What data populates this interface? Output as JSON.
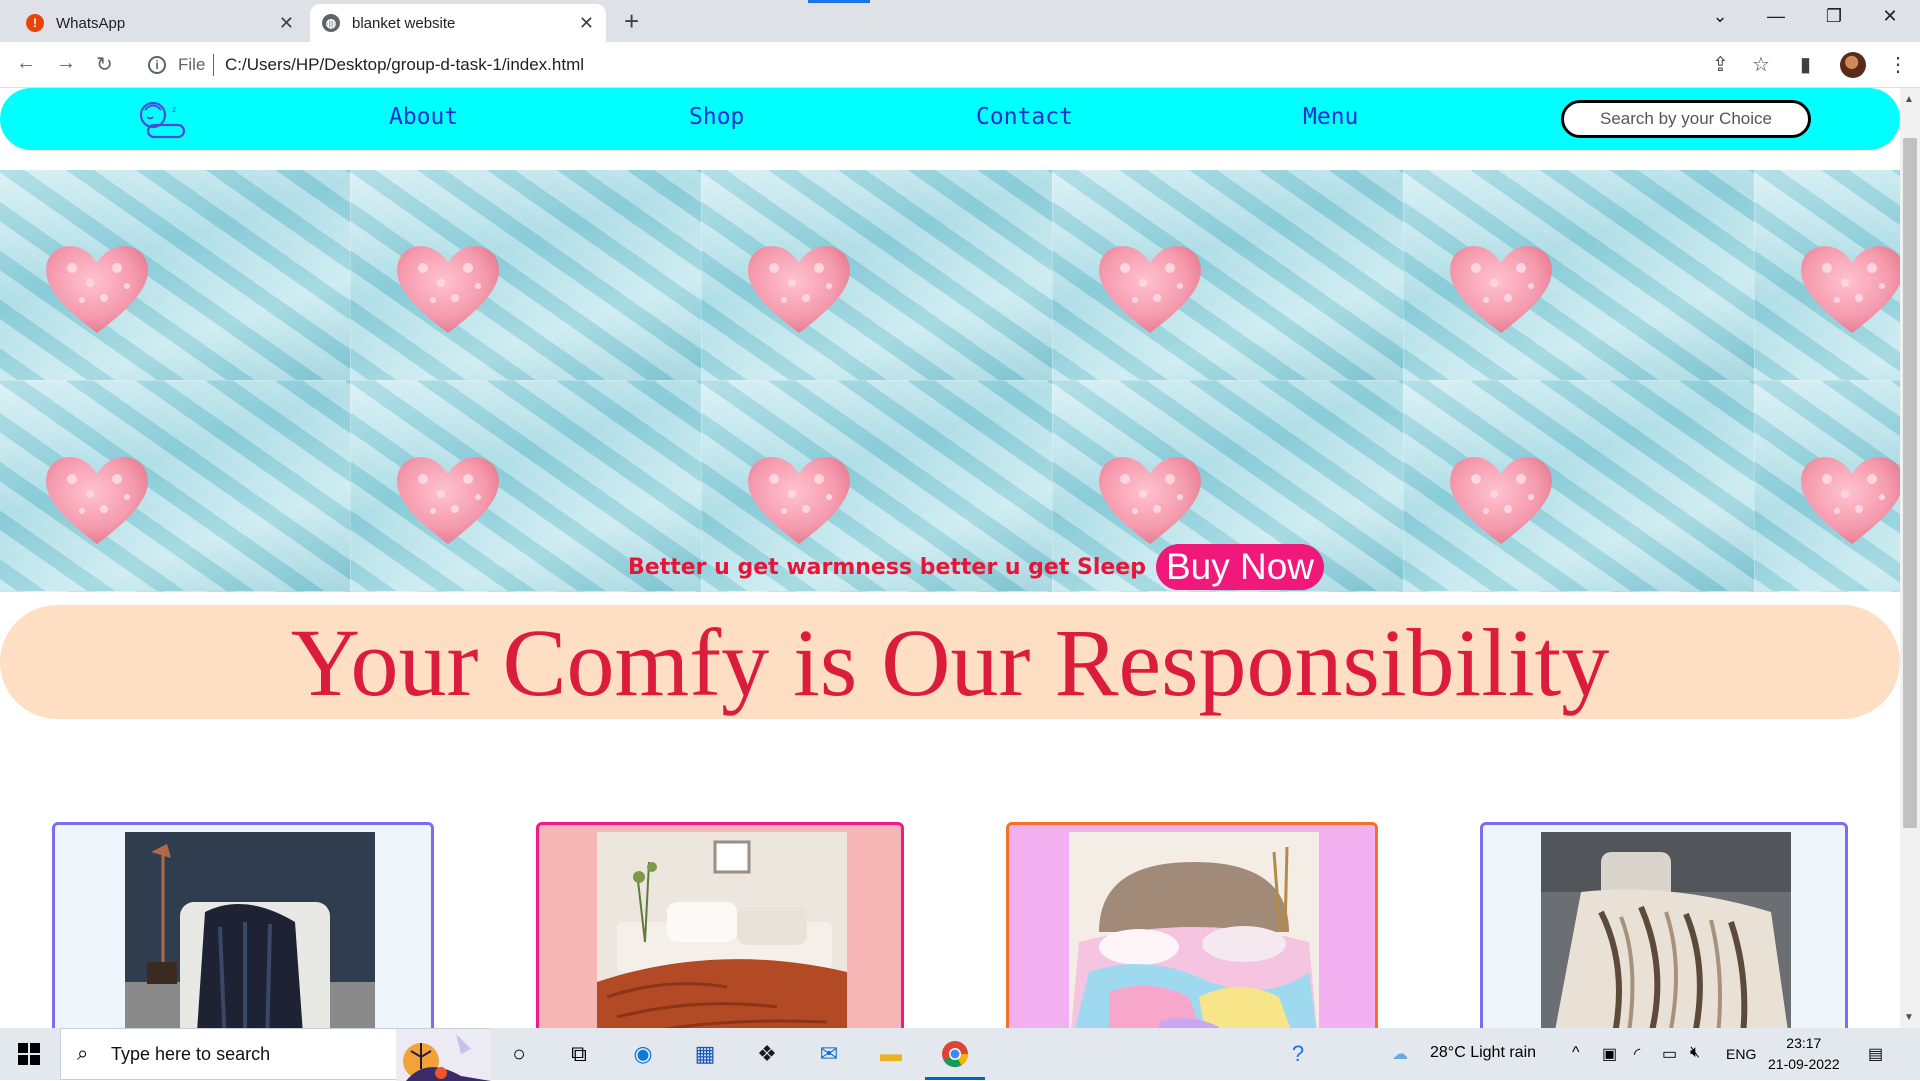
{
  "browser": {
    "tabs": [
      {
        "title": "WhatsApp",
        "active": false
      },
      {
        "title": "blanket website",
        "active": true
      }
    ],
    "url_scheme_label": "File",
    "url": "C:/Users/HP/Desktop/group-d-task-1/index.html"
  },
  "site": {
    "nav": {
      "links": [
        "About",
        "Shop",
        "Contact",
        "Menu"
      ],
      "search_placeholder": "Search by your Choice"
    },
    "hero": {
      "tagline": "Better u get warmness better u get Sleep",
      "cta": "Buy Now"
    },
    "banner": "Your Comfy is Our Responsibility",
    "cards": [
      {
        "name": "navy-blanket-card",
        "border": "#7b6cf0",
        "bg": "#eef6fb"
      },
      {
        "name": "rust-blanket-card",
        "border": "#f01a8c",
        "bg": "#f6b6b6"
      },
      {
        "name": "rainbow-blanket-card",
        "border": "#f5702a",
        "bg": "#f2b0f0"
      },
      {
        "name": "fur-blanket-card",
        "border": "#7b6cf0",
        "bg": "#eef6fb"
      }
    ]
  },
  "taskbar": {
    "search_placeholder": "Type here to search",
    "weather": "28°C  Light rain",
    "language": "ENG",
    "time": "23:17",
    "date": "21-09-2022"
  },
  "colors": {
    "nav_bg": "#00ffff",
    "nav_link": "#1a2fcf",
    "tagline": "#e8153a",
    "cta_bg": "#f0187a",
    "banner_bg": "#ffdfc4",
    "banner_text": "#dc1c3c"
  }
}
